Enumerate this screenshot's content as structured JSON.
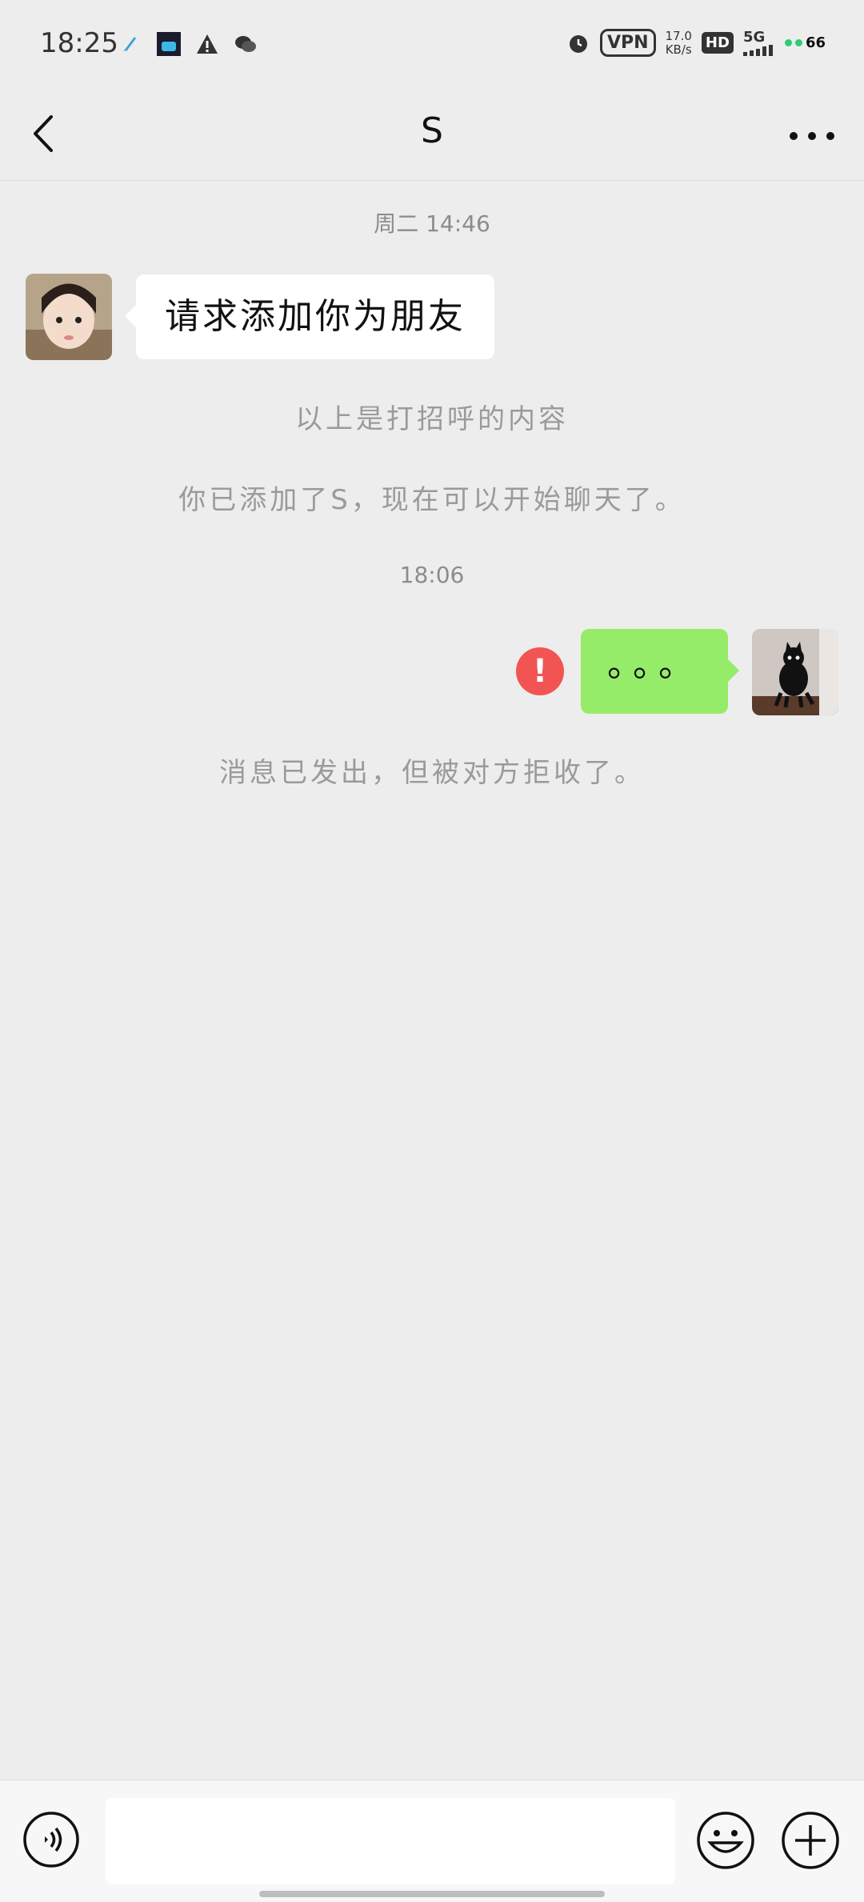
{
  "status_bar": {
    "time": "18:25",
    "left_icons": [
      "rocket-icon",
      "bilibili-icon",
      "warning-icon",
      "wechat-icon"
    ],
    "vpn": "VPN",
    "speed_value": "17.0",
    "speed_unit": "KB/s",
    "hd": "HD",
    "network": "5G",
    "battery": "66"
  },
  "header": {
    "title": "S",
    "back_icon": "chevron-left-icon",
    "more_icon": "more-icon"
  },
  "chat": {
    "timestamp_1": "周二 14:46",
    "incoming_message": "请求添加你为朋友",
    "system_greeting": "以上是打招呼的内容",
    "system_added": "你已添加了S，现在可以开始聊天了。",
    "timestamp_2": "18:06",
    "outgoing_message": "。。。",
    "send_failed_mark": "!",
    "system_rejected": "消息已发出，但被对方拒收了。"
  },
  "input_bar": {
    "value": "",
    "voice_icon": "voice-icon",
    "emoji_icon": "emoji-icon",
    "plus_icon": "plus-icon"
  },
  "colors": {
    "background": "#ededed",
    "outgoing_bubble": "#95ec69",
    "incoming_bubble": "#ffffff",
    "error": "#f25454"
  }
}
